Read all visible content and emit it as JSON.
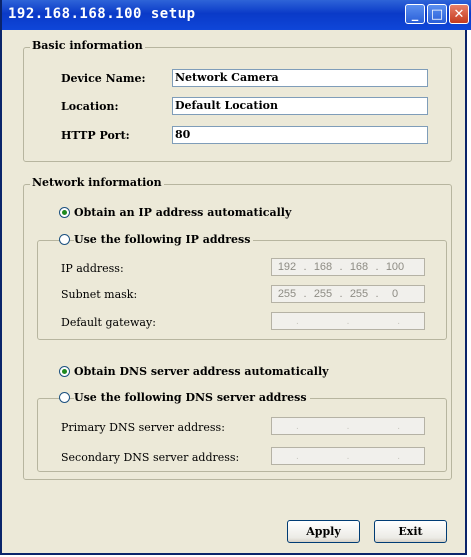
{
  "window": {
    "title": "192.168.168.100 setup"
  },
  "titlebar_buttons": {
    "minimize_icon": "minimize-icon",
    "maximize_icon": "maximize-icon",
    "close_icon": "close-icon"
  },
  "basic": {
    "legend": "Basic information",
    "device_name_label": "Device Name:",
    "device_name_value": "Network Camera",
    "location_label": "Location:",
    "location_value": "Default Location",
    "http_port_label": "HTTP Port:",
    "http_port_value": "80"
  },
  "network": {
    "legend": "Network information",
    "obtain_ip_label": "Obtain an IP address automatically",
    "use_ip_label": "Use the following IP address",
    "ip_address_label": "IP address:",
    "ip_address": [
      "192",
      "168",
      "168",
      "100"
    ],
    "subnet_mask_label": "Subnet mask:",
    "subnet_mask": [
      "255",
      "255",
      "255",
      "0"
    ],
    "gateway_label": "Default gateway:",
    "obtain_dns_label": "Obtain DNS server address automatically",
    "use_dns_label": "Use the following DNS server address",
    "primary_dns_label": "Primary DNS server address:",
    "secondary_dns_label": "Secondary DNS server address:"
  },
  "buttons": {
    "apply": "Apply",
    "exit": "Exit"
  },
  "selection": {
    "ip_mode": "automatic",
    "dns_mode": "automatic"
  }
}
